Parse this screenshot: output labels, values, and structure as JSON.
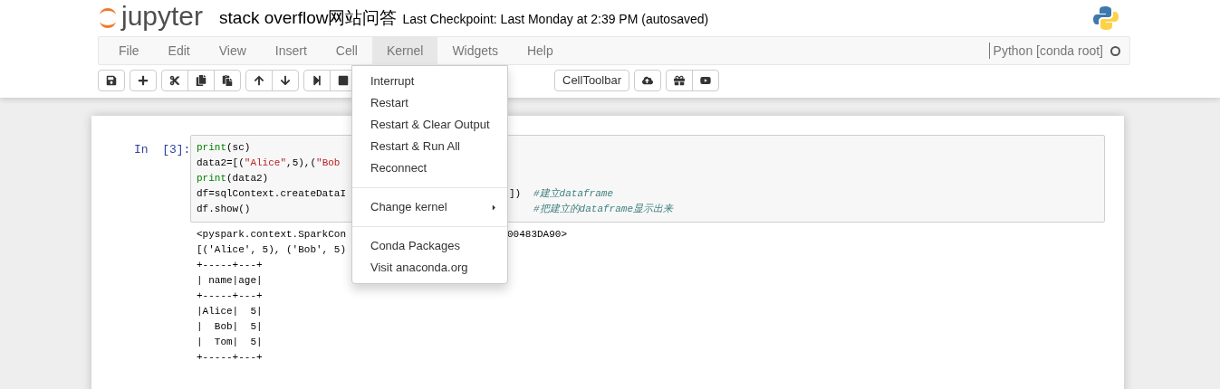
{
  "header": {
    "logo_text": "jupyter",
    "notebook_name": "stack overflow网站问答",
    "checkpoint": "Last Checkpoint: Last Monday at 2:39 PM (autosaved)"
  },
  "menu_bar": {
    "items": [
      {
        "label": "File",
        "selected": false
      },
      {
        "label": "Edit",
        "selected": false
      },
      {
        "label": "View",
        "selected": false
      },
      {
        "label": "Insert",
        "selected": false
      },
      {
        "label": "Cell",
        "selected": false
      },
      {
        "label": "Kernel",
        "selected": true
      },
      {
        "label": "Widgets",
        "selected": false
      },
      {
        "label": "Help",
        "selected": false
      }
    ],
    "kernel_name": "Python [conda root]",
    "kernel_busy": false
  },
  "toolbar": {
    "cell_toolbar_label": "CellToolbar"
  },
  "kernel_menu": [
    {
      "kind": "item",
      "label": "Interrupt"
    },
    {
      "kind": "item",
      "label": "Restart"
    },
    {
      "kind": "item",
      "label": "Restart & Clear Output"
    },
    {
      "kind": "item",
      "label": "Restart & Run All"
    },
    {
      "kind": "item",
      "label": "Reconnect"
    },
    {
      "kind": "divider"
    },
    {
      "kind": "submenu",
      "label": "Change kernel"
    },
    {
      "kind": "divider"
    },
    {
      "kind": "item",
      "label": "Conda Packages"
    },
    {
      "kind": "item",
      "label": "Visit anaconda.org"
    }
  ],
  "cell": {
    "prompt": "In  [3]:",
    "input_lines": [
      {
        "left": [
          {
            "kind": "builtin",
            "text": "print"
          },
          {
            "kind": "plain",
            "text": "(sc)"
          }
        ]
      },
      {
        "left": [
          {
            "kind": "plain",
            "text": "data2=[("
          },
          {
            "kind": "string",
            "text": "\"Alice\""
          },
          {
            "kind": "plain",
            "text": ",5),("
          },
          {
            "kind": "string",
            "text": "\"Bob"
          }
        ]
      },
      {
        "left": [
          {
            "kind": "builtin",
            "text": "print"
          },
          {
            "kind": "plain",
            "text": "(data2)"
          }
        ]
      },
      {
        "left": [
          {
            "kind": "plain",
            "text": "df=sqlContext.createDataI"
          }
        ],
        "right_code": "])",
        "comment": "#建立dataframe"
      },
      {
        "left": [
          {
            "kind": "plain",
            "text": "df.show()"
          }
        ],
        "comment": "#把建立的dataframe显示出来"
      }
    ],
    "output_lines": [
      {
        "left": "<pyspark.context.SparkCon",
        "right": "00483DA90>"
      },
      {
        "left": "[('Alice', 5), ('Bob', 5)"
      },
      {
        "left": "+-----+---+"
      },
      {
        "left": "| name|age|"
      },
      {
        "left": "+-----+---+"
      },
      {
        "left": "|Alice|  5|"
      },
      {
        "left": "|  Bob|  5|"
      },
      {
        "left": "|  Tom|  5|"
      },
      {
        "left": "+-----+---+"
      }
    ]
  }
}
